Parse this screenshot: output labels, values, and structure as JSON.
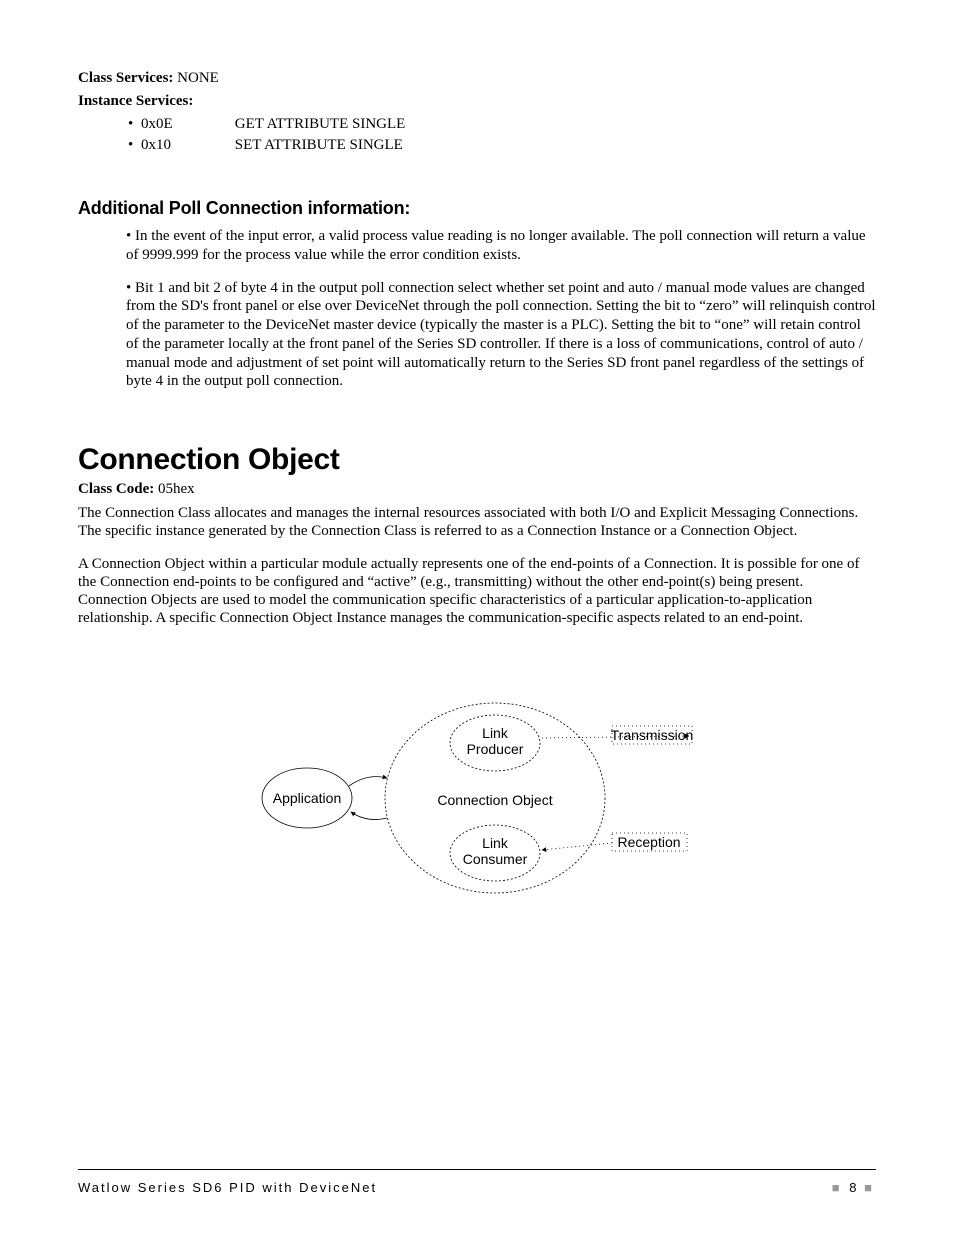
{
  "classServices": {
    "label": "Class Services:",
    "value": "NONE"
  },
  "instanceServices": {
    "label": "Instance Services:",
    "items": [
      {
        "code": "0x0E",
        "name": "GET ATTRIBUTE SINGLE"
      },
      {
        "code": "0x10",
        "name": "SET ATTRIBUTE SINGLE"
      }
    ]
  },
  "pollSection": {
    "heading": "Additional Poll Connection information:",
    "paras": [
      "• In the event of the input error, a valid process value reading is no longer available. The poll connection will return a value of 9999.999 for the process value while the error condition exists.",
      "• Bit 1 and bit 2 of byte 4 in the output poll connection select whether set point and auto / manual mode values are changed from the SD's front panel or else over DeviceNet through the poll connection. Setting the bit to “zero” will relinquish control of the parameter to the DeviceNet master device (typically the master is a PLC). Setting the bit to “one” will retain control of the parameter locally at the front panel of the Series SD controller. If there is a loss of communications, control of auto / manual mode and adjustment of set point will automatically return to the Series SD front panel regardless of the settings of byte 4 in the output poll connection."
    ]
  },
  "connObj": {
    "heading": "Connection Object",
    "classCode": {
      "label": "Class Code:",
      "value": "05hex"
    },
    "paras": [
      "The Connection Class allocates and manages the internal resources associated with both I/O and Explicit Messaging Connections. The specific instance generated by the Connection Class is referred to as a Connection Instance or a Connection Object.",
      "A Connection Object within a particular module actually represents one of the end-points of a Connection. It is possible for one of the Connection end-points to be configured and “active” (e.g., transmitting) without the other end-point(s) being present. Connection Objects are used to model the communication specific characteristics of a particular application-to-application relationship. A specific Connection Object Instance manages the communication-specific aspects related to an end-point."
    ]
  },
  "diagram": {
    "application": "Application",
    "connectionObject": "Connection Object",
    "linkProducer1": "Link",
    "linkProducer2": "Producer",
    "linkConsumer1": "Link",
    "linkConsumer2": "Consumer",
    "transmission": "Transmission",
    "reception": "Reception"
  },
  "footer": {
    "left": "Watlow Series SD6 PID with DeviceNet",
    "page": "8"
  }
}
